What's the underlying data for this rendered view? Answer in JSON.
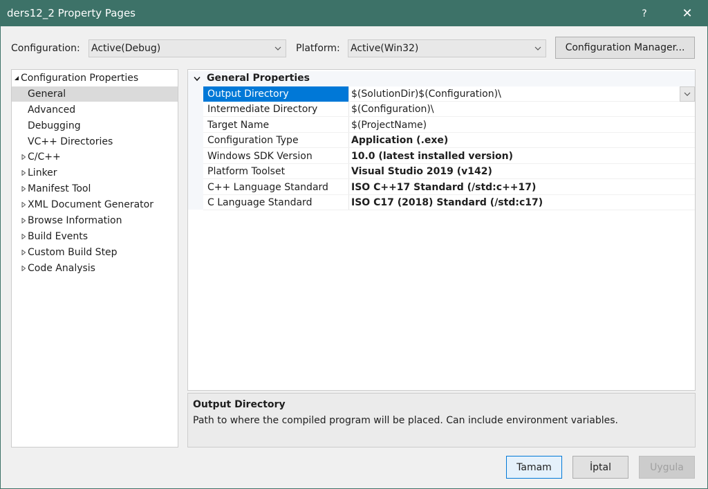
{
  "window": {
    "title": "ders12_2 Property Pages",
    "help_label": "?",
    "close_label": "✕"
  },
  "toolbar": {
    "configuration_label": "Configuration:",
    "configuration_value": "Active(Debug)",
    "platform_label": "Platform:",
    "platform_value": "Active(Win32)",
    "config_manager_label": "Configuration Manager..."
  },
  "tree": {
    "items": [
      {
        "label": "Configuration Properties",
        "expander": "expanded"
      },
      {
        "label": "General",
        "selected": true
      },
      {
        "label": "Advanced"
      },
      {
        "label": "Debugging"
      },
      {
        "label": "VC++ Directories"
      },
      {
        "label": "C/C++",
        "expander": "collapsed"
      },
      {
        "label": "Linker",
        "expander": "collapsed"
      },
      {
        "label": "Manifest Tool",
        "expander": "collapsed"
      },
      {
        "label": "XML Document Generator",
        "expander": "collapsed"
      },
      {
        "label": "Browse Information",
        "expander": "collapsed"
      },
      {
        "label": "Build Events",
        "expander": "collapsed"
      },
      {
        "label": "Custom Build Step",
        "expander": "collapsed"
      },
      {
        "label": "Code Analysis",
        "expander": "collapsed"
      }
    ]
  },
  "grid": {
    "section_title": "General Properties",
    "rows": [
      {
        "name": "Output Directory",
        "value": "$(SolutionDir)$(Configuration)\\",
        "bold": false,
        "selected": true
      },
      {
        "name": "Intermediate Directory",
        "value": "$(Configuration)\\",
        "bold": false
      },
      {
        "name": "Target Name",
        "value": "$(ProjectName)",
        "bold": false
      },
      {
        "name": "Configuration Type",
        "value": "Application (.exe)",
        "bold": true
      },
      {
        "name": "Windows SDK Version",
        "value": "10.0 (latest installed version)",
        "bold": true
      },
      {
        "name": "Platform Toolset",
        "value": "Visual Studio 2019 (v142)",
        "bold": true
      },
      {
        "name": "C++ Language Standard",
        "value": "ISO C++17 Standard (/std:c++17)",
        "bold": true
      },
      {
        "name": "C Language Standard",
        "value": "ISO C17 (2018) Standard (/std:c17)",
        "bold": true
      }
    ]
  },
  "description": {
    "title": "Output Directory",
    "text": "Path to where the compiled program will be placed. Can include environment variables."
  },
  "buttons": {
    "ok_label": "Tamam",
    "cancel_label": "İptal",
    "apply_label": "Uygula"
  },
  "colors": {
    "titlebar": "#3d7268",
    "selection": "#0078d7",
    "tree_selection": "#dadada"
  }
}
